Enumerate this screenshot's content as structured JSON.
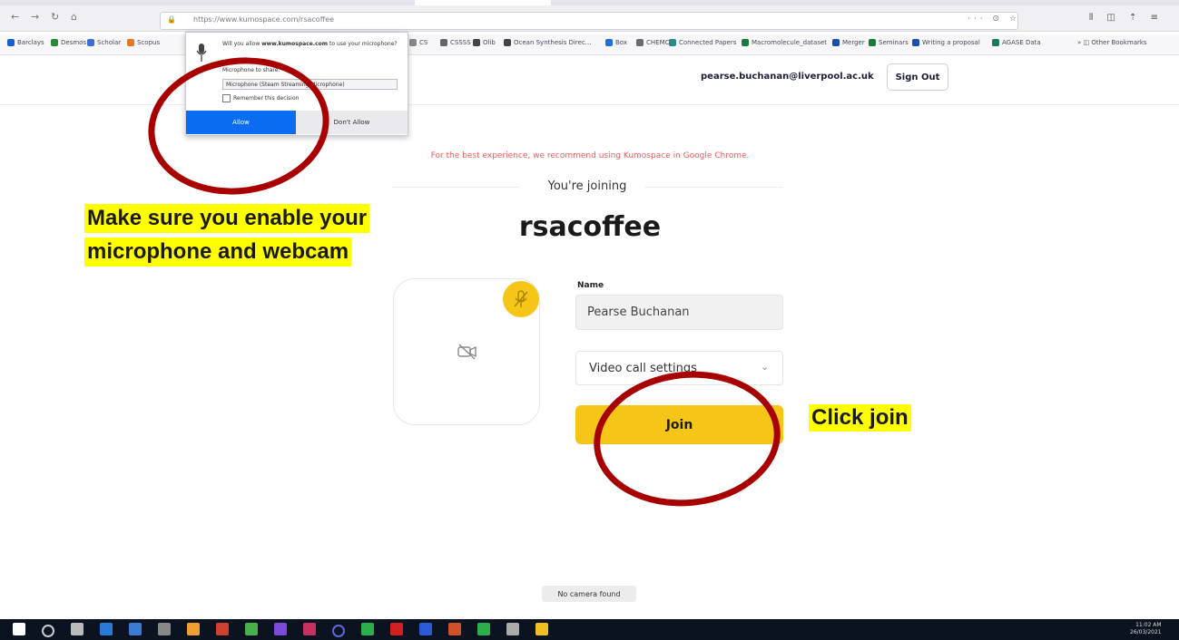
{
  "browser": {
    "url": "https://www.kumospace.com/rsacoffee",
    "nav_glyphs": [
      "←",
      "→",
      "↻",
      "⌂"
    ],
    "page_actions": "··· ⊙ ☆",
    "right_icons": "⫴ ◫ ⇡ ≡",
    "bookmarks": [
      {
        "label": "Barclays",
        "color": "#1a5fcf"
      },
      {
        "label": "Desmos",
        "color": "#2a8a3a"
      },
      {
        "label": "Scholar",
        "color": "#3b6fd8"
      },
      {
        "label": "Scopus",
        "color": "#e87722"
      },
      {
        "label": "CS",
        "color": "#888888"
      },
      {
        "label": "CSSSS",
        "color": "#666666"
      },
      {
        "label": "Olib",
        "color": "#444444"
      },
      {
        "label": "Ocean Synthesis Direc...",
        "color": "#444444"
      },
      {
        "label": "Box",
        "color": "#1f6fe0"
      },
      {
        "label": "CHEMC",
        "color": "#6b6b6b"
      },
      {
        "label": "Connected Papers",
        "color": "#2a8a8a"
      },
      {
        "label": "Macromolecule_dataset",
        "color": "#1a7a3a"
      },
      {
        "label": "Merger",
        "color": "#1a4fb0"
      },
      {
        "label": "Seminars",
        "color": "#1a7a3a"
      },
      {
        "label": "Writing a proposal",
        "color": "#1a4fb0"
      },
      {
        "label": "AGASE Data",
        "color": "#1a7a5a"
      }
    ],
    "other_bookmarks": "»  ◫ Other Bookmarks"
  },
  "permission_popup": {
    "question_prefix": "Will you allow ",
    "question_site": "www.kumospace.com",
    "question_suffix": " to use your microphone?",
    "microphone_label": "Microphone to share:",
    "microphone_selected": "Microphone (Steam Streaming Microphone)",
    "remember_label": "Remember this decision",
    "allow_label": "Allow",
    "dont_allow_label": "Don't Allow"
  },
  "header": {
    "user_email": "pearse.buchanan@liverpool.ac.uk",
    "sign_out_label": "Sign Out"
  },
  "main": {
    "recommend_text": "For the best experience, we recommend using Kumospace in Google Chrome.",
    "joining_label": "You're joining",
    "room_name": "rsacoffee",
    "name_label": "Name",
    "name_value": "Pearse Buchanan",
    "video_settings_label": "Video call settings",
    "join_label": "Join",
    "no_camera": "No camera found"
  },
  "annotations": {
    "line1": "Make sure you enable your",
    "line2": "microphone and webcam",
    "click_join": "Click join",
    "ring_color": "#a80000",
    "highlight_color": "#ffff00"
  },
  "colors": {
    "accent_yellow": "#f5c518",
    "allow_blue": "#0a6cf0",
    "warning_red": "#ef5b5b"
  },
  "taskbar": {
    "icons": [
      "windows-start",
      "search",
      "task-view",
      "store",
      "mail",
      "git",
      "files",
      "tool",
      "image",
      "vs",
      "app",
      "circle",
      "spotify",
      "acrobat",
      "word",
      "powerpoint",
      "green",
      "settings",
      "chrome"
    ],
    "time": "11:02 AM",
    "date": "26/03/2021"
  }
}
